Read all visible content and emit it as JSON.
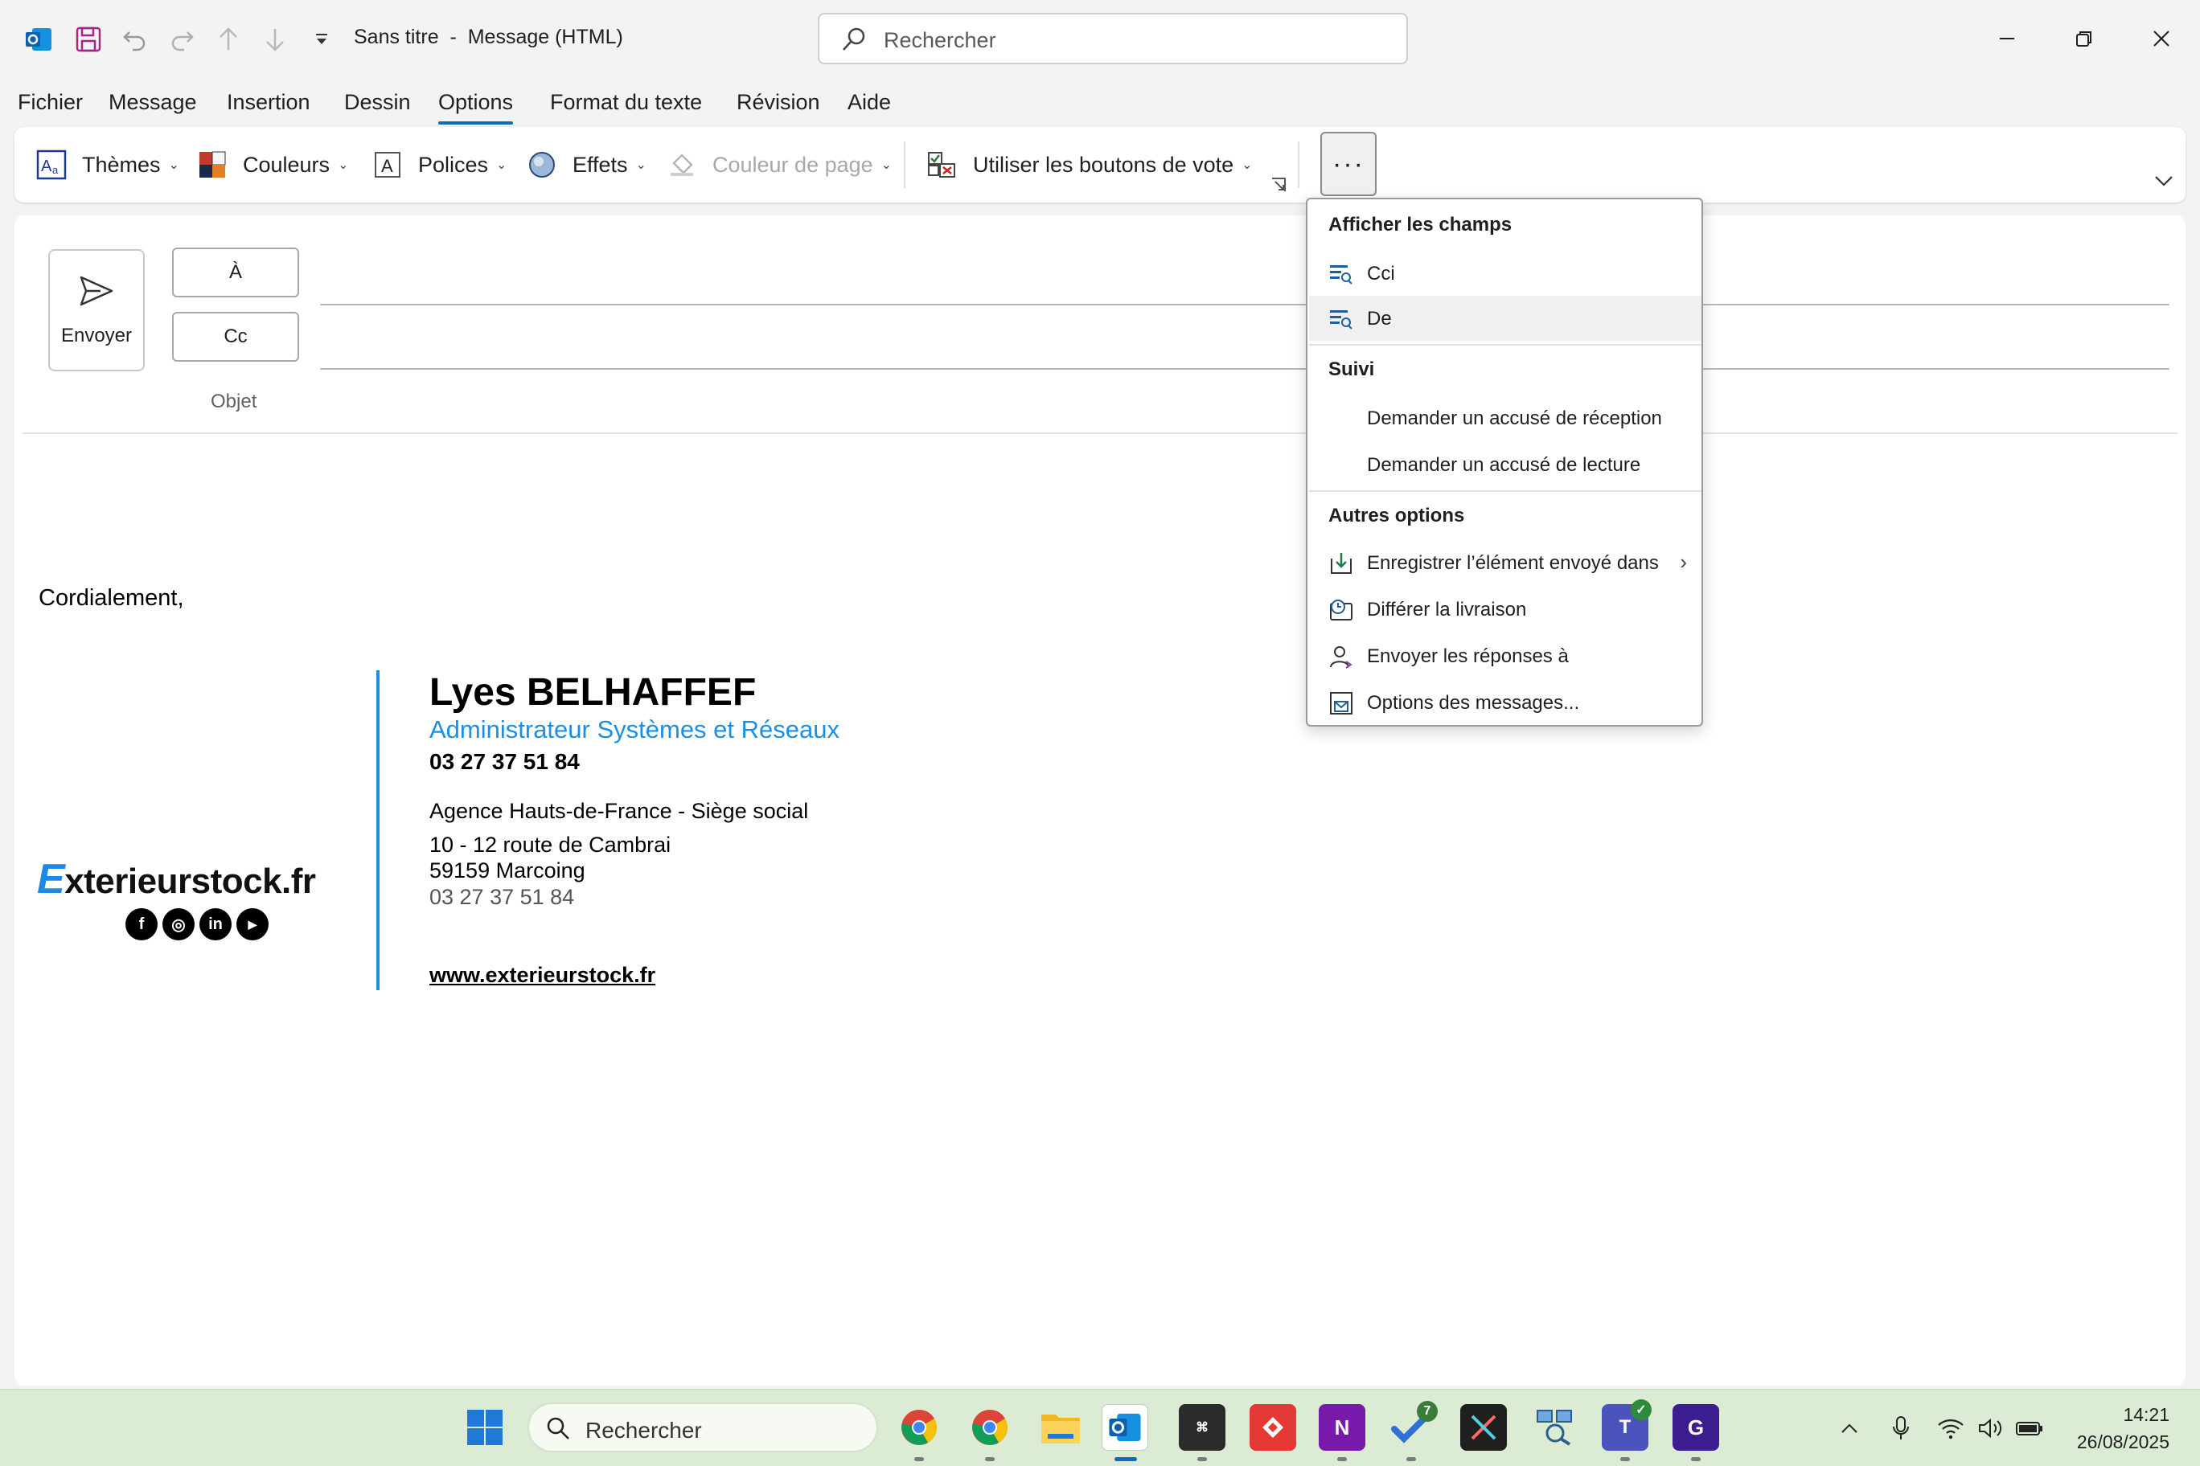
{
  "titlebar": {
    "doc_title": "Sans titre  -  Message (HTML)",
    "search_placeholder": "Rechercher"
  },
  "menu": {
    "items": [
      "Fichier",
      "Message",
      "Insertion",
      "Dessin",
      "Options",
      "Format du texte",
      "Révision",
      "Aide"
    ],
    "active": "Options"
  },
  "ribbon": {
    "themes": "Thèmes",
    "colors": "Couleurs",
    "fonts": "Polices",
    "effects": "Effets",
    "page_color": "Couleur de page",
    "vote": "Utiliser les boutons de vote",
    "more": "···"
  },
  "compose": {
    "send": "Envoyer",
    "to": "À",
    "cc": "Cc",
    "subject_label": "Objet",
    "body": "Cordialement,"
  },
  "signature": {
    "brand_initial": "E",
    "brand_rest": "xterieurstock.fr",
    "socials": [
      "f",
      "◎",
      "in",
      "▶"
    ],
    "name": "Lyes BELHAFFEF",
    "role": "Administrateur Systèmes et Réseaux",
    "phone_bold": "03 27 37 51 84",
    "agency": "Agence Hauts-de-France - Siège social",
    "address_line1": "10 - 12 route de Cambrai",
    "address_line2": "59159 Marcoing",
    "phone": "03 27 37 51 84",
    "website": "www.exterieurstock.fr"
  },
  "dropdown": {
    "section1": "Afficher les champs",
    "cci": "Cci",
    "de": "De",
    "section2": "Suivi",
    "receipt": "Demander un accusé de réception",
    "read": "Demander un accusé de lecture",
    "section3": "Autres options",
    "save_sent": "Enregistrer l’élément envoyé dans",
    "delay": "Différer la livraison",
    "reply_to": "Envoyer les réponses à",
    "msg_options": "Options des messages..."
  },
  "taskbar": {
    "search_placeholder": "Rechercher",
    "todo_badge": "7",
    "time": "14:21",
    "date": "26/08/2025"
  },
  "colors": {
    "accent": "#0f6cbd",
    "signature_blue": "#1a8fe3",
    "taskbar_bg": "#dcebd4"
  }
}
